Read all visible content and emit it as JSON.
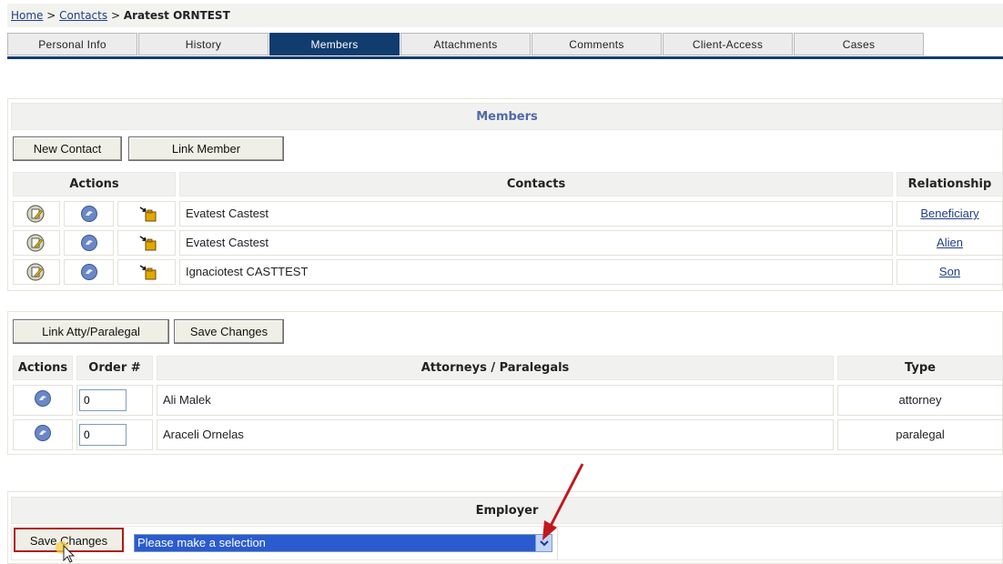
{
  "breadcrumb": {
    "home": "Home",
    "sep1": ">",
    "contacts": "Contacts",
    "sep2": ">",
    "current": "Aratest  ORNTEST"
  },
  "tabs": [
    {
      "label": "Personal Info"
    },
    {
      "label": "History"
    },
    {
      "label": "Members",
      "active": true
    },
    {
      "label": "Attachments"
    },
    {
      "label": "Comments"
    },
    {
      "label": "Client-Access"
    },
    {
      "label": "Cases"
    }
  ],
  "members": {
    "title": "Members",
    "new_contact_label": "New Contact",
    "link_member_label": "Link Member",
    "headers": {
      "actions": "Actions",
      "contacts": "Contacts",
      "relationship": "Relationship"
    },
    "rows": [
      {
        "name": "Evatest  Castest",
        "relationship": "Beneficiary"
      },
      {
        "name": "Evatest  Castest",
        "relationship": "Alien"
      },
      {
        "name": "Ignaciotest  CASTTEST",
        "relationship": "Son"
      }
    ]
  },
  "attorneys": {
    "link_label": "Link Atty/Paralegal",
    "save_label": "Save Changes",
    "headers": {
      "actions": "Actions",
      "order": "Order #",
      "name": "Attorneys / Paralegals",
      "type": "Type"
    },
    "rows": [
      {
        "order": "0",
        "name": "Ali  Malek",
        "type": "attorney"
      },
      {
        "order": "0",
        "name": "Araceli  Ornelas",
        "type": "paralegal"
      }
    ]
  },
  "employer": {
    "title": "Employer",
    "save_label": "Save Changes",
    "select_value": "Please make a selection"
  },
  "icons": {
    "edit": "edit-icon",
    "unlink": "unlink-icon",
    "goto": "goto-contact-icon"
  },
  "colors": {
    "tab_active": "#113c6e",
    "link": "#1f3f88",
    "select_bg": "#2a5bd0",
    "annotation_red": "#c0181e"
  }
}
